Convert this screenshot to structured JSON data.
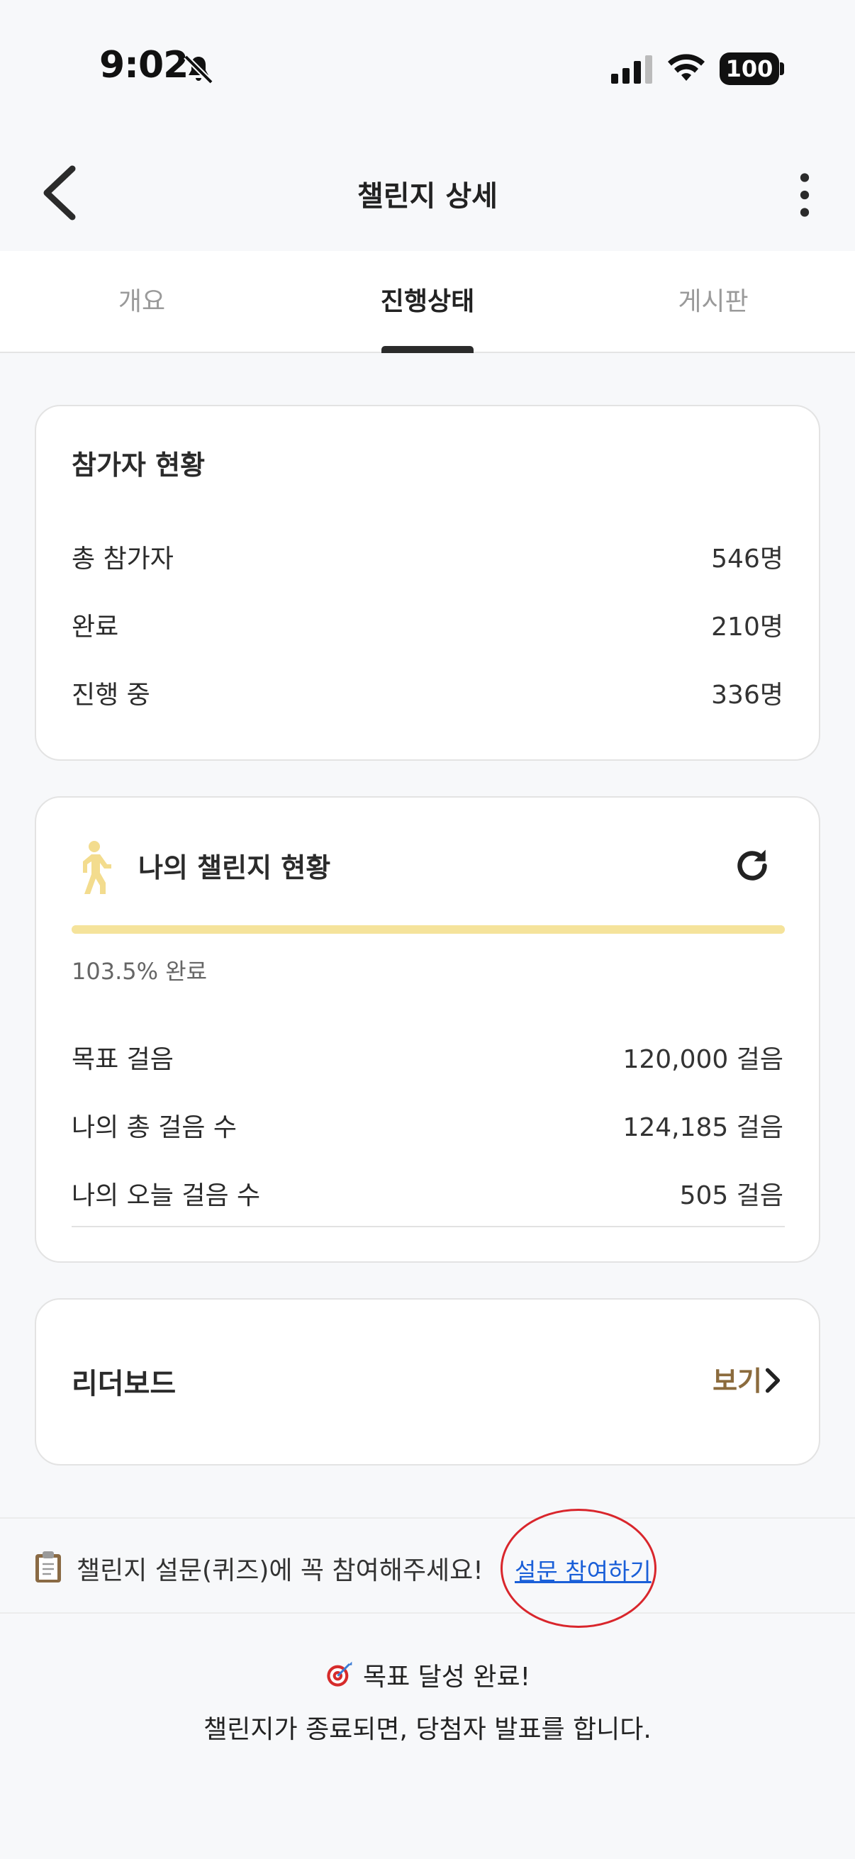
{
  "status_bar": {
    "time": "9:02",
    "battery": "100"
  },
  "header": {
    "title": "챌린지 상세"
  },
  "tabs": [
    {
      "label": "개요",
      "active": false
    },
    {
      "label": "진행상태",
      "active": true
    },
    {
      "label": "게시판",
      "active": false
    }
  ],
  "participants": {
    "title": "참가자 현황",
    "rows": [
      {
        "label": "총 참가자",
        "value": "546명"
      },
      {
        "label": "완료",
        "value": "210명"
      },
      {
        "label": "진행 중",
        "value": "336명"
      }
    ]
  },
  "my_challenge": {
    "title": "나의 챌린지 현황",
    "progress_percent": 103.5,
    "progress_text": "103.5% 완료",
    "rows": [
      {
        "label": "목표 걸음",
        "value": "120,000 걸음"
      },
      {
        "label": "나의 총 걸음 수",
        "value": "124,185 걸음"
      },
      {
        "label": "나의 오늘 걸음 수",
        "value": "505 걸음"
      }
    ]
  },
  "leaderboard": {
    "label": "리더보드",
    "view_label": "보기"
  },
  "survey_banner": {
    "text": "챌린지 설문(퀴즈)에 꼭 참여해주세요!",
    "link": "설문 참여하기"
  },
  "footer": {
    "goal_text": "목표 달성 완료!",
    "sub_text": "챌린지가 종료되면, 당첨자 발표를 합니다."
  },
  "colors": {
    "accent": "#8b6b3d",
    "progress": "#f5e39b",
    "link": "#1a5fd8",
    "highlight": "#d9262c"
  }
}
